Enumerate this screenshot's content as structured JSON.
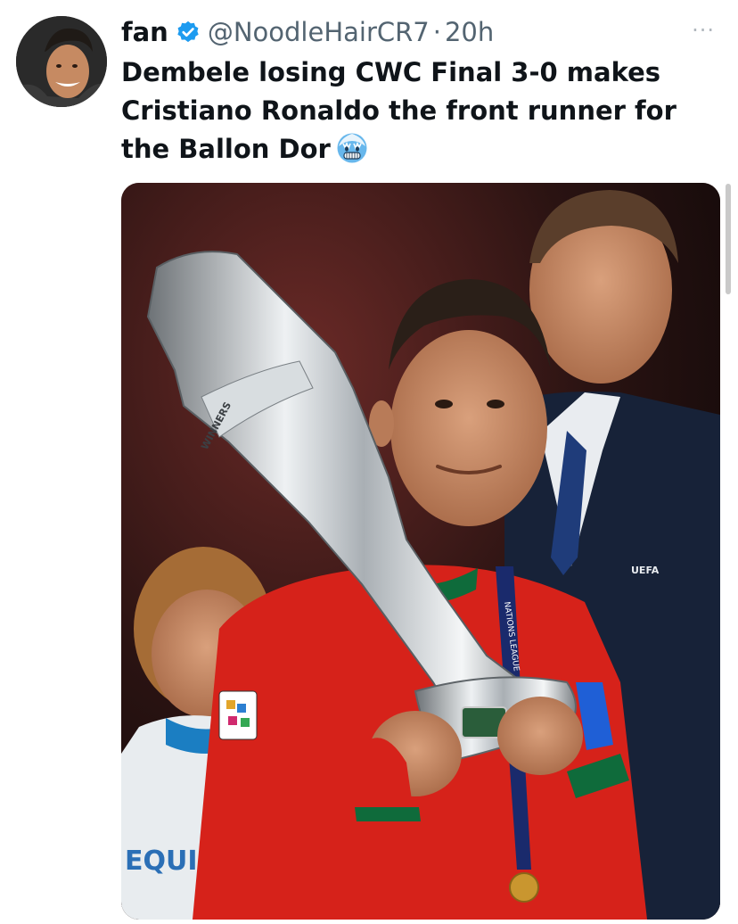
{
  "tweet": {
    "display_name": "fan",
    "handle": "@NoodleHairCR7",
    "separator": "·",
    "time": "20h",
    "more_label": "···",
    "text": "Dembele losing CWC Final 3-0 makes Cristiano Ronaldo the front runner for the Ballon Dor",
    "emoji": "cold-face-emoji"
  },
  "media": {
    "trophy_text": "WINNERS",
    "badge_text": "UEFA",
    "lanyard_text": "NATIONS LEAGUE",
    "boy_shirt_text": "EQUI",
    "description_icons": [
      "trophy-icon",
      "medal-icon"
    ]
  },
  "colors": {
    "verified_blue": "#1d9bf0",
    "muted_text": "#536471",
    "jersey_red": "#d6221a",
    "suit_navy": "#172238"
  }
}
